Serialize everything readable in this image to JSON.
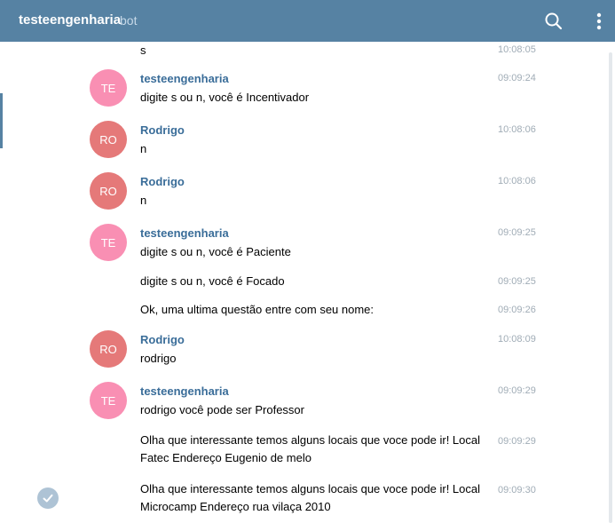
{
  "header": {
    "title": "testeengenharia",
    "subtitle": "bot",
    "search_icon": "search-icon",
    "more_icon": "more-vertical-icon"
  },
  "colors": {
    "header_bg": "#5682a3",
    "name": "#3a6d99",
    "avatar_te": "#f98fb3",
    "avatar_ro": "#e57979",
    "time": "#a0acb6"
  },
  "messages": [
    {
      "text": "s",
      "time": "10:08:05"
    },
    {
      "initials": "TE",
      "author": "testeengenharia",
      "text": "digite s ou n, você é Incentivador",
      "time": "09:09:24"
    },
    {
      "initials": "RO",
      "author": "Rodrigo",
      "text": "n",
      "time": "10:08:06"
    },
    {
      "initials": "RO",
      "author": "Rodrigo",
      "text": "n",
      "time": "10:08:06"
    },
    {
      "initials": "TE",
      "author": "testeengenharia",
      "text": "digite s ou n, você é Paciente",
      "time": "09:09:25"
    },
    {
      "text": "digite s ou n, você é Focado",
      "time": "09:09:25"
    },
    {
      "text": "Ok, uma ultima questão entre com seu nome:",
      "time": "09:09:26"
    },
    {
      "initials": "RO",
      "author": "Rodrigo",
      "text": "rodrigo",
      "time": "10:08:09"
    },
    {
      "initials": "TE",
      "author": "testeengenharia",
      "text": "rodrigo você pode ser Professor",
      "time": "09:09:29"
    },
    {
      "text": "Olha que interessante temos alguns locais que voce pode ir! Local Fatec Endereço Eugenio de melo",
      "time": "09:09:29"
    },
    {
      "text": "Olha que interessante temos alguns locais que voce pode ir! Local Microcamp Endereço rua vilaça 2010",
      "time": "09:09:30"
    }
  ]
}
